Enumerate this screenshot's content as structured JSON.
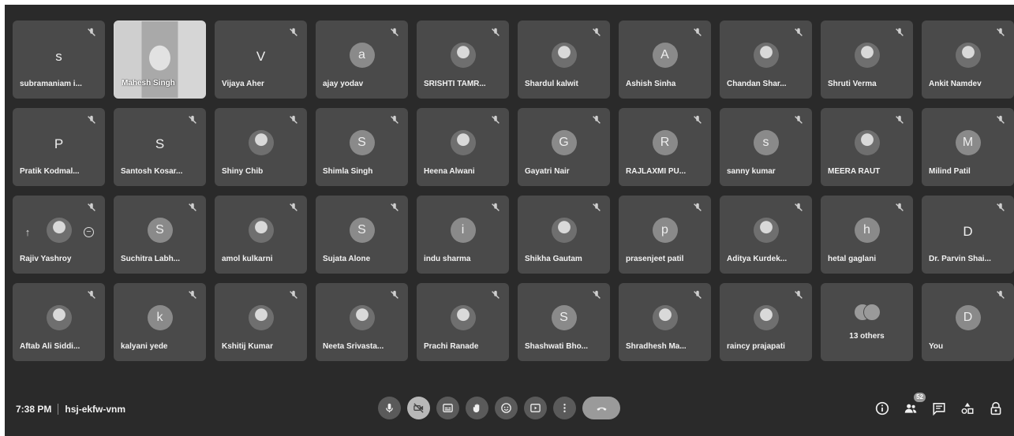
{
  "meeting": {
    "time": "7:38 PM",
    "code": "hsj-ekfw-vnm"
  },
  "participants_badge": "52",
  "tiles": [
    {
      "name": "subramaniam i...",
      "kind": "letter",
      "initial": "s"
    },
    {
      "name": "Mahesh Singh",
      "kind": "video"
    },
    {
      "name": "Vijaya Aher",
      "kind": "letter",
      "initial": "V"
    },
    {
      "name": "ajay yodav",
      "kind": "circle",
      "initial": "a"
    },
    {
      "name": "SRISHTI TAMR...",
      "kind": "photo"
    },
    {
      "name": "Shardul kalwit",
      "kind": "photo"
    },
    {
      "name": "Ashish Sinha",
      "kind": "circle",
      "initial": "A"
    },
    {
      "name": "Chandan Shar...",
      "kind": "photo"
    },
    {
      "name": "Shruti Verma",
      "kind": "photo"
    },
    {
      "name": "Ankit Namdev",
      "kind": "photo"
    },
    {
      "name": "Pratik Kodmal...",
      "kind": "letter",
      "initial": "P"
    },
    {
      "name": "Santosh Kosar...",
      "kind": "letter",
      "initial": "S"
    },
    {
      "name": "Shiny Chib",
      "kind": "photo"
    },
    {
      "name": "Shimla Singh",
      "kind": "circle",
      "initial": "S"
    },
    {
      "name": "Heena Alwani",
      "kind": "photo"
    },
    {
      "name": "Gayatri Nair",
      "kind": "circle",
      "initial": "G"
    },
    {
      "name": "RAJLAXMI PU...",
      "kind": "circle",
      "initial": "R"
    },
    {
      "name": "sanny kumar",
      "kind": "circle",
      "initial": "s"
    },
    {
      "name": "MEERA RAUT",
      "kind": "photo"
    },
    {
      "name": "Milind Patil",
      "kind": "circle",
      "initial": "M"
    },
    {
      "name": "Rajiv Yashroy",
      "kind": "special"
    },
    {
      "name": "Suchitra Labh...",
      "kind": "circle",
      "initial": "S"
    },
    {
      "name": "amol kulkarni",
      "kind": "photo"
    },
    {
      "name": "Sujata Alone",
      "kind": "circle",
      "initial": "S"
    },
    {
      "name": "indu sharma",
      "kind": "circle",
      "initial": "i"
    },
    {
      "name": "Shikha Gautam",
      "kind": "photo"
    },
    {
      "name": "prasenjeet patil",
      "kind": "circle",
      "initial": "p"
    },
    {
      "name": "Aditya Kurdek...",
      "kind": "photo"
    },
    {
      "name": "hetal gaglani",
      "kind": "circle",
      "initial": "h"
    },
    {
      "name": "Dr. Parvin Shai...",
      "kind": "letter",
      "initial": "D"
    },
    {
      "name": "Aftab Ali Siddi...",
      "kind": "photo"
    },
    {
      "name": "kalyani yede",
      "kind": "circle",
      "initial": "k"
    },
    {
      "name": "Kshitij Kumar",
      "kind": "photo"
    },
    {
      "name": "Neeta Srivasta...",
      "kind": "photo"
    },
    {
      "name": "Prachi Ranade",
      "kind": "photo"
    },
    {
      "name": "Shashwati Bho...",
      "kind": "circle",
      "initial": "S"
    },
    {
      "name": "Shradhesh Ma...",
      "kind": "photo"
    },
    {
      "name": "raincy prajapati",
      "kind": "photo"
    },
    {
      "name": "13 others",
      "kind": "others"
    },
    {
      "name": "You",
      "kind": "circle",
      "initial": "D"
    }
  ],
  "controls": [
    {
      "name": "mic-button",
      "icon": "mic-icon"
    },
    {
      "name": "camera-button",
      "icon": "camera-off-icon",
      "off": true
    },
    {
      "name": "captions-button",
      "icon": "captions-icon"
    },
    {
      "name": "raise-hand-button",
      "icon": "hand-icon"
    },
    {
      "name": "reactions-button",
      "icon": "emoji-icon"
    },
    {
      "name": "present-button",
      "icon": "present-icon"
    },
    {
      "name": "more-options-button",
      "icon": "more-vert-icon"
    },
    {
      "name": "leave-call-button",
      "icon": "hangup-icon",
      "leave": true
    }
  ],
  "right_controls": [
    {
      "name": "meeting-details-button",
      "icon": "info-icon"
    },
    {
      "name": "people-button",
      "icon": "people-icon"
    },
    {
      "name": "chat-button",
      "icon": "chat-icon"
    },
    {
      "name": "activities-button",
      "icon": "shapes-icon"
    },
    {
      "name": "host-controls-button",
      "icon": "lock-person-icon"
    }
  ]
}
